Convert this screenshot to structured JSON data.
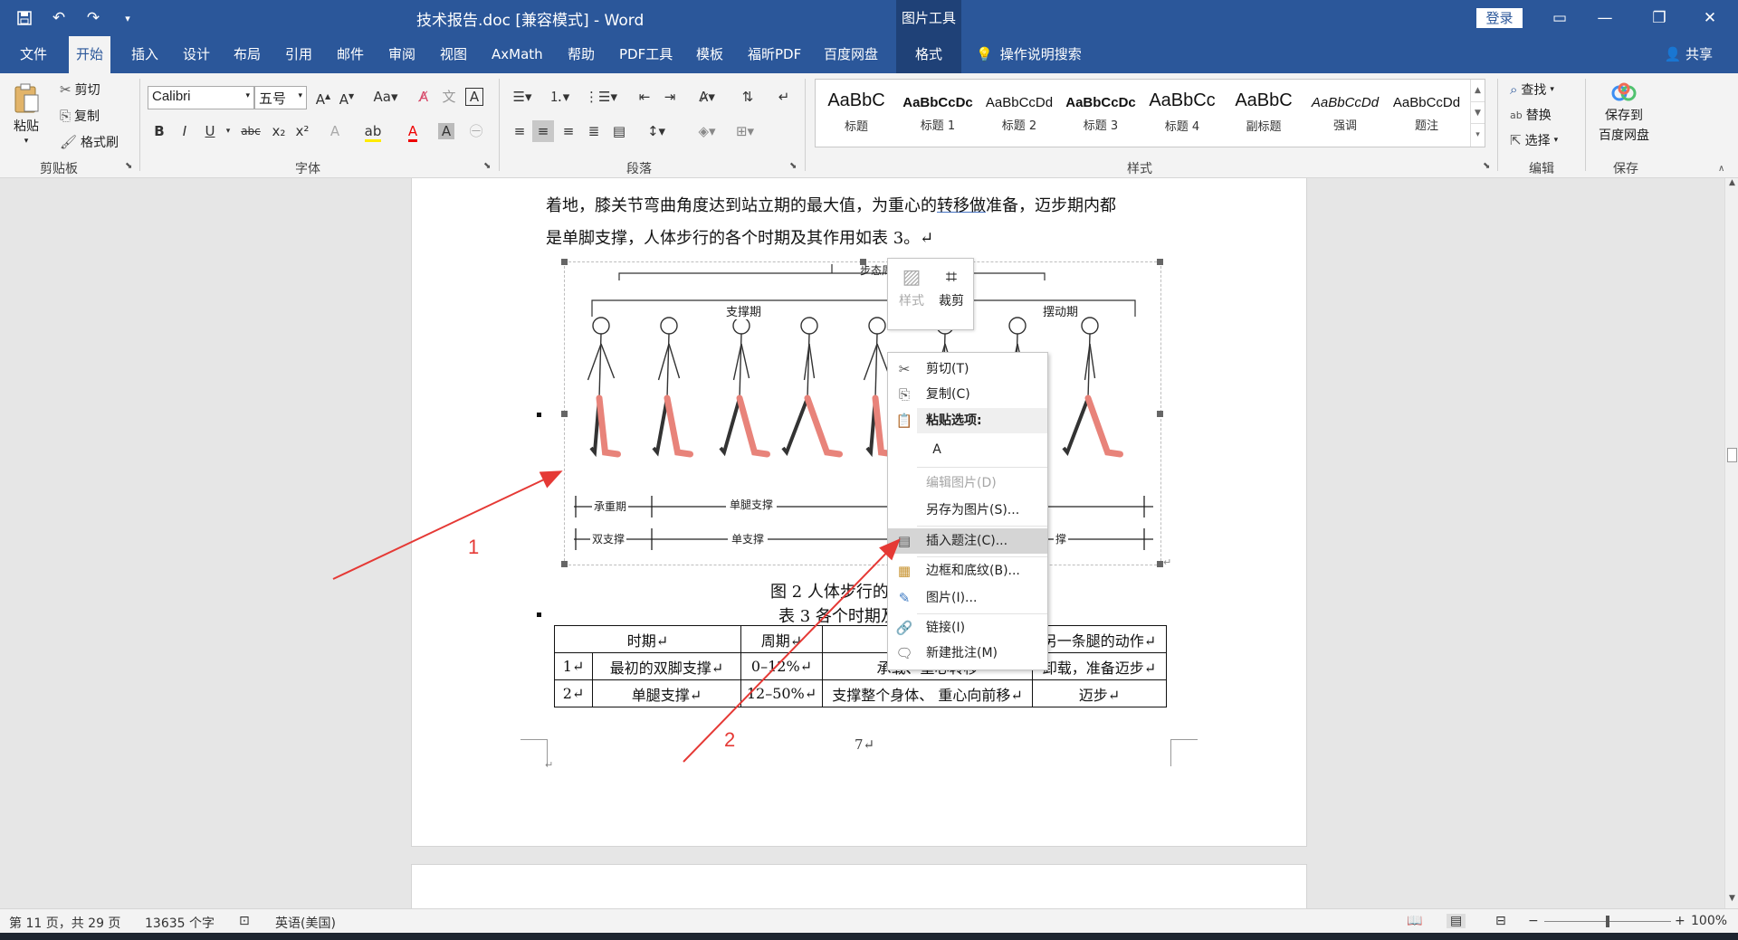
{
  "titlebar": {
    "document_title": "技术报告.doc [兼容模式]  -  Word",
    "context_tool": "图片工具",
    "login_label": "登录",
    "icons": [
      "save-icon",
      "undo-icon",
      "redo-icon",
      "customize-icon"
    ]
  },
  "tabs": [
    "文件",
    "开始",
    "插入",
    "设计",
    "布局",
    "引用",
    "邮件",
    "审阅",
    "视图",
    "AxMath",
    "帮助",
    "PDF工具",
    "模板",
    "福昕PDF",
    "百度网盘",
    "格式"
  ],
  "active_tab": "开始",
  "tell_me": "操作说明搜索",
  "share": "共享",
  "ribbon": {
    "clipboard": {
      "paste": "粘贴",
      "cut": "剪切",
      "copy": "复制",
      "format_painter": "格式刷",
      "label": "剪贴板"
    },
    "font": {
      "name": "Calibri",
      "size": "五号",
      "label": "字体"
    },
    "paragraph": {
      "label": "段落"
    },
    "styles": {
      "label": "样式",
      "items": [
        {
          "sample": "AaBbC",
          "name": "标题"
        },
        {
          "sample": "AaBbCcDc",
          "name": "标题 1"
        },
        {
          "sample": "AaBbCcDd",
          "name": "标题 2"
        },
        {
          "sample": "AaBbCcDc",
          "name": "标题 3"
        },
        {
          "sample": "AaBbCc",
          "name": "标题 4"
        },
        {
          "sample": "AaBbC",
          "name": "副标题"
        },
        {
          "sample": "AaBbCcDd",
          "name": "强调"
        },
        {
          "sample": "AaBbCcDd",
          "name": "题注"
        }
      ]
    },
    "editing": {
      "find": "查找",
      "replace": "替换",
      "select": "选择",
      "label": "编辑"
    },
    "save": {
      "button": "保存到百度网盘",
      "line1": "保存到",
      "line2": "百度网盘",
      "label": "保存"
    }
  },
  "document": {
    "line1_a": "着地，膝关节弯曲角度达到站立期的最大值，为重心的",
    "line1_link": "转移做",
    "line1_b": "准备，迈步期内都",
    "line2": "是单脚支撑，人体步行的各个时期及其作用如表 3。↵",
    "figure_labels": {
      "top": "步态周期",
      "stance": "支撑期",
      "swing": "摆动期",
      "phase1": "承重期",
      "phase2": "单腿支撑",
      "phase3": "双支撑",
      "phase4": "单支撑",
      "phase5": "撑"
    },
    "figure_caption": "图 2 人体步行的",
    "table_caption": "表 3 各个时期及",
    "table": {
      "header": [
        "时期↵",
        "周期↵",
        "",
        "另一条腿的动作↵"
      ],
      "rows": [
        [
          "1↵",
          "最初的双脚支撑↵",
          "0–12%↵",
          "承载、重心转移",
          "卸载，准备迈步↵"
        ],
        [
          "2↵",
          "单腿支撑↵",
          "12–50%↵",
          "支撑整个身体、 重心向前移↵",
          "迈步↵"
        ]
      ]
    },
    "page_number": "7↵",
    "paragraph_mark": "↵"
  },
  "mini_toolbar": {
    "style": "样式",
    "crop": "裁剪"
  },
  "context_menu": {
    "items": [
      {
        "label": "剪切(T)",
        "icon": "scissors-icon",
        "state": "normal"
      },
      {
        "label": "复制(C)",
        "icon": "copy-icon",
        "state": "normal"
      },
      {
        "label": "编辑图片(D)",
        "icon": "",
        "state": "disabled"
      },
      {
        "label": "另存为图片(S)...",
        "icon": "",
        "state": "normal"
      },
      {
        "label": "插入题注(C)...",
        "icon": "caption-icon",
        "state": "highlight"
      },
      {
        "label": "边框和底纹(B)...",
        "icon": "borders-icon",
        "state": "normal"
      },
      {
        "label": "图片(I)...",
        "icon": "picture-icon",
        "state": "normal"
      },
      {
        "label": "链接(I)",
        "icon": "link-icon",
        "state": "normal"
      },
      {
        "label": "新建批注(M)",
        "icon": "comment-icon",
        "state": "normal"
      }
    ],
    "paste_header": "粘贴选项:",
    "paste_option": "A"
  },
  "annotations": {
    "arrow1": "1",
    "arrow2": "2",
    "color": "#e53935"
  },
  "statusbar": {
    "page": "第 11 页，共 29 页",
    "words": "13635 个字",
    "language": "英语(美国)",
    "zoom": "100%"
  },
  "colors": {
    "accent": "#2b579a",
    "leg_highlight": "#e8837a"
  }
}
